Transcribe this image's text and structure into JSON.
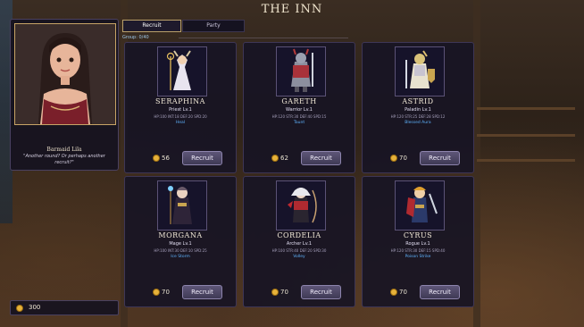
{
  "screen": {
    "title": "THE INN"
  },
  "tabs": [
    {
      "label": "Recruit",
      "active": true
    },
    {
      "label": "Party",
      "active": false
    }
  ],
  "group_label": "Group: 0/40",
  "npc": {
    "name": "Barmaid Lila",
    "quote": "\"Another round? Or perhaps another recruit?\""
  },
  "heroes": [
    {
      "name": "SERAPHINA",
      "class_level": "Priest Lv.1",
      "stats": "HP:100  INT:18  DEF:20  SPD:20",
      "skill": "Heal",
      "cost": "56",
      "button": "Recruit"
    },
    {
      "name": "GARETH",
      "class_level": "Warrior Lv.1",
      "stats": "HP:120  STR:30  DEF:40  SPD:15",
      "skill": "Taunt",
      "cost": "62",
      "button": "Recruit"
    },
    {
      "name": "ASTRID",
      "class_level": "Paladin Lv.1",
      "stats": "HP:120  STR:25  DEF:28  SPD:12",
      "skill": "Blessed Aura",
      "cost": "70",
      "button": "Recruit"
    },
    {
      "name": "MORGANA",
      "class_level": "Mage Lv.1",
      "stats": "HP:100  INT:30  DEF:10  SPD:25",
      "skill": "Ice Storm",
      "cost": "70",
      "button": "Recruit"
    },
    {
      "name": "CORDELIA",
      "class_level": "Archer Lv.1",
      "stats": "HP:100  STR:40  DEF:20  SPD:30",
      "skill": "Volley",
      "cost": "70",
      "button": "Recruit"
    },
    {
      "name": "CYRUS",
      "class_level": "Rogue Lv.1",
      "stats": "HP:120  STR:30  DEF:15  SPD:40",
      "skill": "Poison Strike",
      "cost": "70",
      "button": "Recruit"
    }
  ],
  "gold": {
    "amount": "300"
  },
  "colors": {
    "accent": "#b9a06a",
    "skill": "#5fb4ff",
    "gold": "#e7b23a"
  }
}
